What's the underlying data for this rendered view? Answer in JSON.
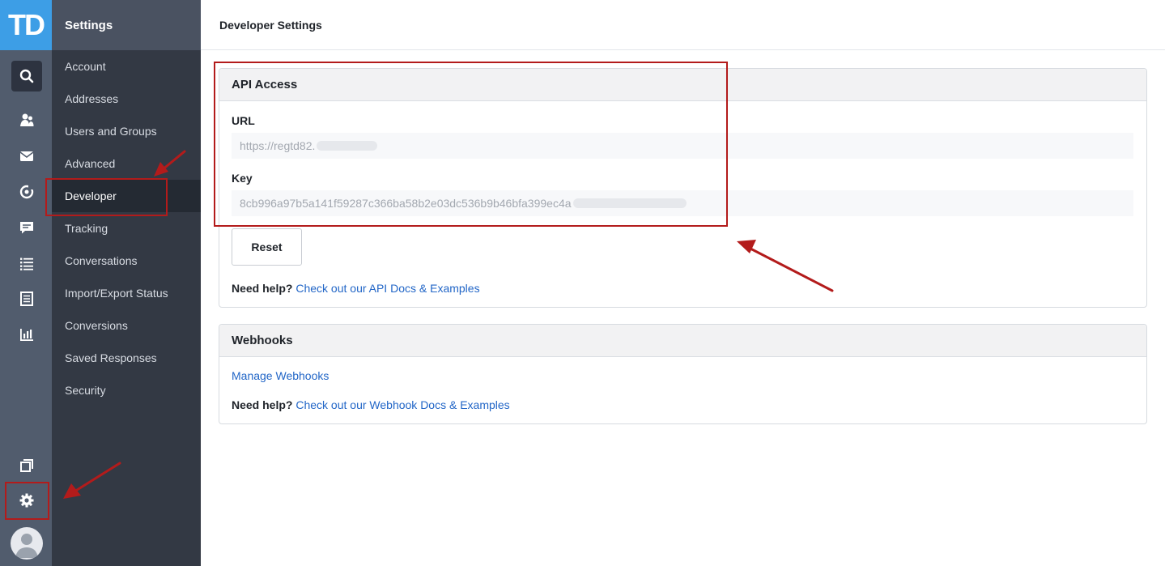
{
  "logo": "TD",
  "rail": {
    "icons": [
      "search-icon",
      "users-icon",
      "mail-icon",
      "campaign-icon",
      "chat-icon",
      "list-icon",
      "document-icon",
      "reports-icon",
      "windows-icon",
      "gear-icon",
      "avatar-icon"
    ]
  },
  "subnav": {
    "title": "Settings",
    "items": [
      {
        "label": "Account"
      },
      {
        "label": "Addresses"
      },
      {
        "label": "Users and Groups"
      },
      {
        "label": "Advanced"
      },
      {
        "label": "Developer"
      },
      {
        "label": "Tracking"
      },
      {
        "label": "Conversations"
      },
      {
        "label": "Import/Export Status"
      },
      {
        "label": "Conversions"
      },
      {
        "label": "Saved Responses"
      },
      {
        "label": "Security"
      }
    ],
    "active_index": 4
  },
  "page_title": "Developer Settings",
  "api": {
    "title": "API Access",
    "url_label": "URL",
    "url_value": "https://regtd82.",
    "key_label": "Key",
    "key_value": "8cb996a97b5a141f59287c366ba58b2e03dc536b9b46bfa399ec4a",
    "reset_label": "Reset",
    "help_prefix": "Need help?",
    "help_link": "Check out our API Docs & Examples"
  },
  "webhooks": {
    "title": "Webhooks",
    "manage_link": "Manage Webhooks",
    "help_prefix": "Need help?",
    "help_link": "Check out our Webhook Docs & Examples"
  },
  "colors": {
    "brand": "#3d9ee6",
    "link": "#2266c7",
    "annotation": "#b31b1b"
  }
}
